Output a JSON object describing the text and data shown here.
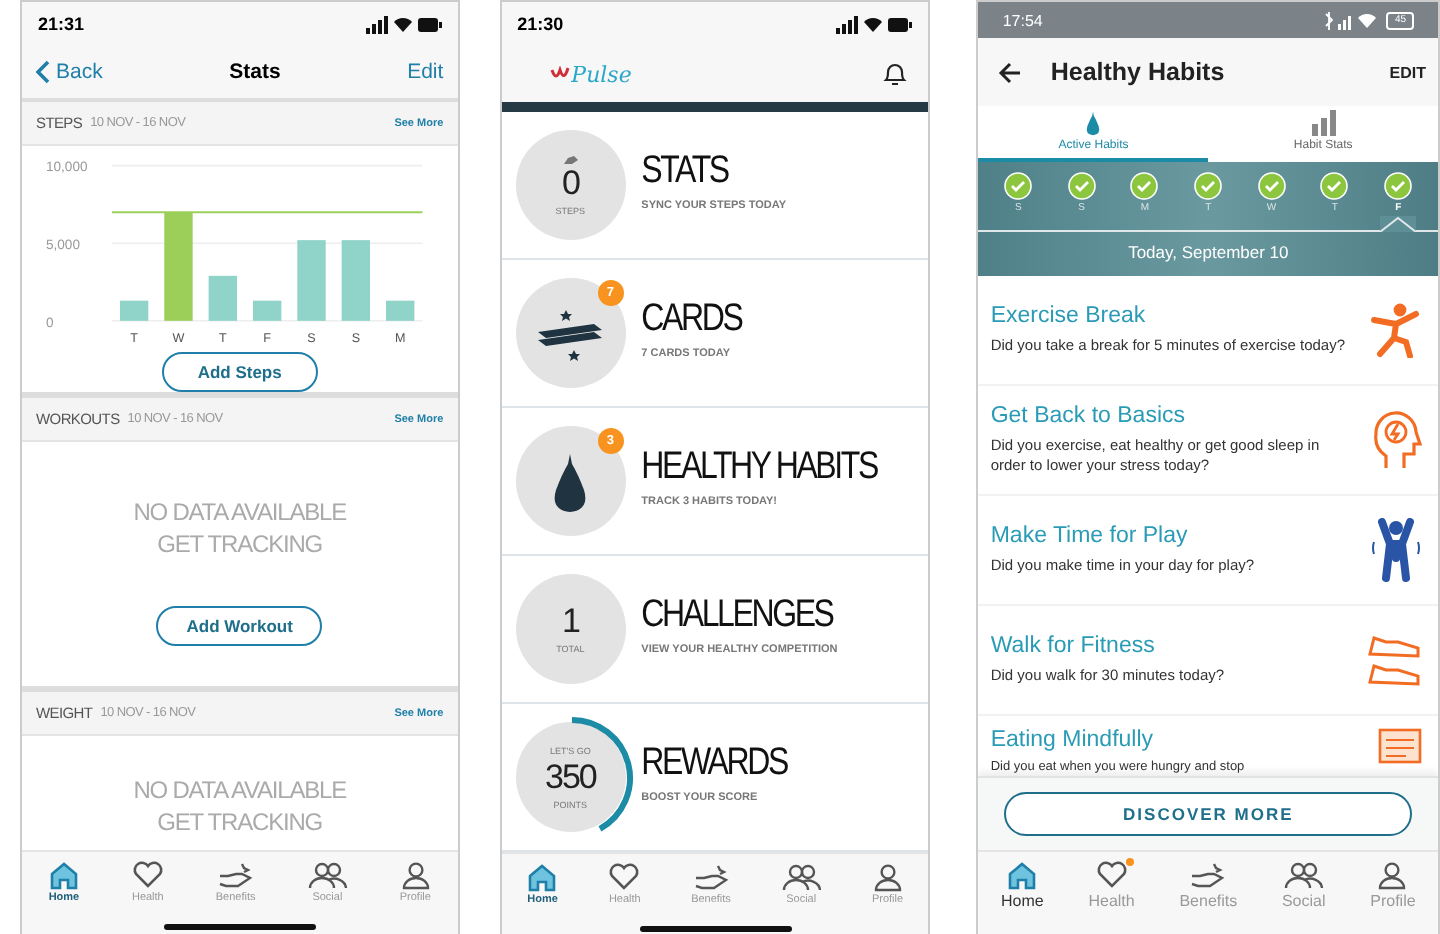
{
  "stats_screen": {
    "status_bar": {
      "time": "21:31"
    },
    "nav": {
      "back": "Back",
      "title": "Stats",
      "action": "Edit"
    },
    "sections": [
      {
        "title": "STEPS",
        "range": "10 NOV - 16 NOV",
        "link": "See More",
        "button": "Add Steps",
        "chart_data": {
          "type": "bar",
          "categories": [
            "T",
            "W",
            "T",
            "F",
            "S",
            "S",
            "M"
          ],
          "series": [
            {
              "color": "#8fd3c9",
              "values": [
                1300,
                null,
                2900,
                1300,
                5200,
                5200,
                1300
              ]
            },
            {
              "color": "#9ccf5a",
              "values": [
                null,
                7000,
                null,
                null,
                null,
                null,
                null
              ]
            }
          ],
          "ylim": [
            0,
            10000
          ],
          "yticks": [
            {
              "value": 0,
              "label": "0"
            },
            {
              "value": 5000,
              "label": "5,000"
            },
            {
              "value": 10000,
              "label": "10,000"
            }
          ],
          "ref_lines": [
            {
              "axis": "y",
              "value": 7000,
              "color": "#9ccf5a"
            }
          ]
        }
      },
      {
        "title": "WORKOUTS",
        "range": "10 NOV - 16 NOV",
        "link": "See More",
        "empty_lines": [
          "NO DATA AVAILABLE",
          "GET TRACKING"
        ],
        "button": "Add Workout"
      },
      {
        "title": "WEIGHT",
        "range": "10 NOV - 16 NOV",
        "link": "See More",
        "empty_lines": [
          "NO DATA AVAILABLE",
          "GET TRACKING"
        ]
      }
    ],
    "tab_bar": [
      {
        "label": "Home",
        "selected": true
      },
      {
        "label": "Health",
        "selected": false
      },
      {
        "label": "Benefits",
        "selected": false
      },
      {
        "label": "Social",
        "selected": false
      },
      {
        "label": "Profile",
        "selected": false
      }
    ]
  },
  "home_screen": {
    "status_bar": {
      "time": "21:30"
    },
    "logo": "Pulse",
    "items": [
      {
        "kind": "count",
        "value": "0",
        "caption": "STEPS",
        "title": "STATS",
        "subtitle": "SYNC YOUR STEPS TODAY"
      },
      {
        "kind": "icon",
        "badge": "7",
        "title": "CARDS",
        "subtitle": "7 CARDS TODAY"
      },
      {
        "kind": "icon",
        "badge": "3",
        "title": "HEALTHY HABITS",
        "subtitle": "TRACK 3 HABITS TODAY!"
      },
      {
        "kind": "count",
        "value": "1",
        "caption": "TOTAL",
        "title": "CHALLENGES",
        "subtitle": "VIEW YOUR HEALTHY COMPETITION"
      },
      {
        "kind": "progress",
        "top": "LET'S GO",
        "value": "350",
        "caption": "POINTS",
        "level": 0.42,
        "title": "REWARDS",
        "subtitle": "BOOST YOUR SCORE"
      }
    ],
    "tab_bar": [
      {
        "label": "Home",
        "selected": true
      },
      {
        "label": "Health",
        "selected": false
      },
      {
        "label": "Benefits",
        "selected": false
      },
      {
        "label": "Social",
        "selected": false
      },
      {
        "label": "Profile",
        "selected": false
      }
    ]
  },
  "habits_screen": {
    "status_bar": {
      "time": "17:54",
      "battery": "45"
    },
    "header": {
      "title": "Healthy Habits",
      "action": "EDIT"
    },
    "tabs": [
      {
        "label": "Active Habits",
        "selected": true
      },
      {
        "label": "Habit Stats",
        "selected": false
      }
    ],
    "days": [
      {
        "label": "S",
        "checked": true,
        "selected": false
      },
      {
        "label": "S",
        "checked": true,
        "selected": false
      },
      {
        "label": "M",
        "checked": true,
        "selected": false
      },
      {
        "label": "T",
        "checked": true,
        "selected": false
      },
      {
        "label": "W",
        "checked": true,
        "selected": false
      },
      {
        "label": "T",
        "checked": true,
        "selected": false
      },
      {
        "label": "F",
        "checked": true,
        "selected": true
      }
    ],
    "date": "Today, September 10",
    "habits": [
      {
        "title": "Exercise Break",
        "question": "Did you take a break for 5 minutes of exercise today?"
      },
      {
        "title": "Get Back to Basics",
        "question": "Did you exercise, eat healthy or get good sleep in order to lower your stress today?"
      },
      {
        "title": "Make Time for Play",
        "question": "Did you make time in your day for play?"
      },
      {
        "title": "Walk for Fitness",
        "question": "Did you walk for 30 minutes today?"
      },
      {
        "title": "Eating Mindfully",
        "question": "Did you eat when you were hungry and stop"
      }
    ],
    "button": "DISCOVER MORE",
    "tab_bar": [
      {
        "label": "Home",
        "selected": true,
        "dot": false
      },
      {
        "label": "Health",
        "selected": false,
        "dot": true
      },
      {
        "label": "Benefits",
        "selected": false,
        "dot": false
      },
      {
        "label": "Social",
        "selected": false,
        "dot": false
      },
      {
        "label": "Profile",
        "selected": false,
        "dot": false
      }
    ]
  }
}
